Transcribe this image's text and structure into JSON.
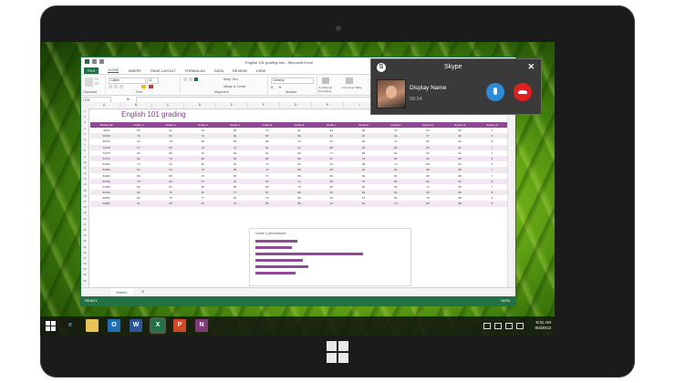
{
  "excel": {
    "window_title": "English 101 grading.xlsx - Microsoft Excel",
    "tabs": [
      "FILE",
      "HOME",
      "INSERT",
      "PAGE LAYOUT",
      "FORMULAS",
      "DATA",
      "REVIEW",
      "VIEW"
    ],
    "font_name": "Calibri",
    "font_size": "11",
    "number_format": "General",
    "wrap_text": "Wrap Text",
    "merge_center": "Merge & Center",
    "group_clipboard": "Clipboard",
    "group_font": "Font",
    "group_alignment": "Alignment",
    "group_number": "Number",
    "conditional_formatting": "Conditional Formatting",
    "format_as_table": "Format as Table",
    "name_box": "D3",
    "fx": "fx",
    "columns": [
      "A",
      "B",
      "C",
      "D",
      "E",
      "F",
      "G",
      "H",
      "I",
      "J",
      "K",
      "L",
      "M"
    ],
    "sheet_title": "English 101 grading",
    "sheet_tab": "Sheet1",
    "status": "READY",
    "zoom": "100%",
    "table": {
      "headers": [
        "Student ID",
        "Grade 1",
        "Grade 2",
        "Grade 3",
        "Grade 4",
        "Grade 5",
        "Grade 6",
        "Grade 7",
        "Grade 8",
        "Grade 9",
        "Grade 10",
        "Grade 11",
        "Grade 12"
      ],
      "rows": [
        [
          "3019",
          "85",
          "92",
          "70",
          "88",
          "79",
          "91",
          "84",
          "96",
          "72",
          "84",
          "88",
          "7"
        ],
        [
          "50700",
          "78",
          "81",
          "74",
          "90",
          "85",
          "60",
          "92",
          "84",
          "94",
          "77",
          "86",
          "6"
        ],
        [
          "50701",
          "92",
          "78",
          "89",
          "68",
          "88",
          "79",
          "87",
          "96",
          "73",
          "82",
          "82",
          "8"
        ],
        [
          "71578",
          "67",
          "85",
          "78",
          "73",
          "84",
          "97",
          "88",
          "80",
          "89",
          "85",
          "80",
          "7"
        ],
        [
          "71579",
          "83",
          "89",
          "76",
          "84",
          "91",
          "80",
          "77",
          "86",
          "80",
          "90",
          "94",
          "7"
        ],
        [
          "51576",
          "94",
          "79",
          "88",
          "82",
          "86",
          "88",
          "87",
          "79",
          "82",
          "93",
          "86",
          "8"
        ],
        [
          "51483",
          "73",
          "92",
          "82",
          "92",
          "70",
          "83",
          "81",
          "88",
          "72",
          "88",
          "84",
          "9"
        ],
        [
          "51484",
          "91",
          "93",
          "79",
          "86",
          "73",
          "88",
          "95",
          "90",
          "84",
          "88",
          "88",
          "7"
        ],
        [
          "51484",
          "88",
          "85",
          "79",
          "86",
          "73",
          "88",
          "95",
          "90",
          "84",
          "88",
          "88",
          "7"
        ],
        [
          "91510",
          "78",
          "93",
          "87",
          "91",
          "84",
          "74",
          "86",
          "75",
          "89",
          "81",
          "82",
          "8"
        ],
        [
          "51480",
          "85",
          "82",
          "86",
          "88",
          "85",
          "78",
          "95",
          "82",
          "82",
          "73",
          "80",
          "7"
        ],
        [
          "91510",
          "84",
          "76",
          "82",
          "77",
          "87",
          "89",
          "83",
          "84",
          "83",
          "85",
          "85",
          "8"
        ],
        [
          "60782",
          "89",
          "75",
          "77",
          "93",
          "79",
          "88",
          "92",
          "87",
          "86",
          "79",
          "88",
          "9"
        ],
        [
          "60682",
          "91",
          "98",
          "81",
          "72",
          "85",
          "88",
          "93",
          "81",
          "79",
          "86",
          "88",
          "8"
        ]
      ]
    },
    "chart": {
      "title": "Grade 1 performance"
    }
  },
  "skype": {
    "app_name": "Skype",
    "display_name": "Display Name",
    "duration": "00:34"
  },
  "taskbar": {
    "time": "9:31 AM",
    "date": "8/4/2013"
  }
}
